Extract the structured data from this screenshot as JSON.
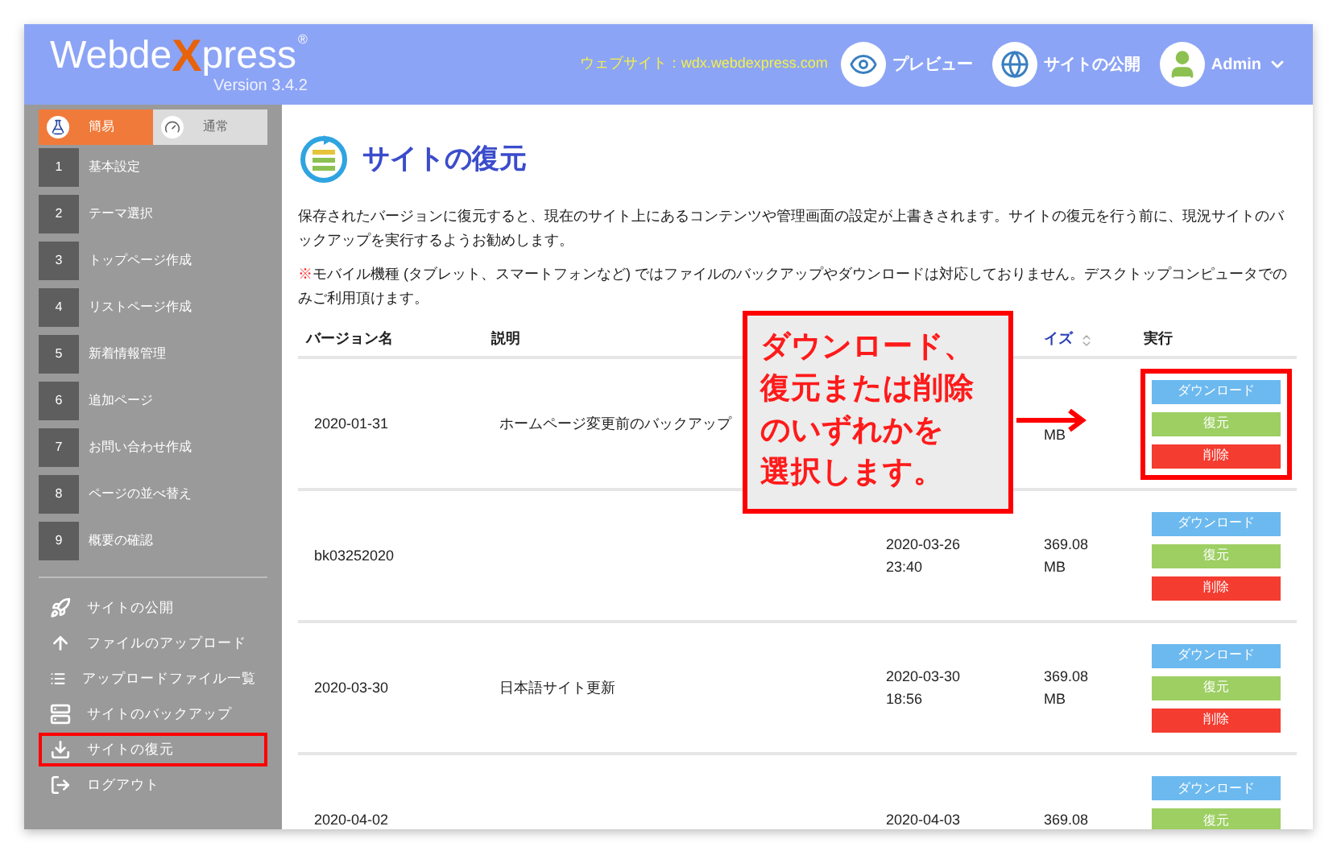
{
  "header": {
    "logo_parts": [
      "Webde",
      "X",
      "press"
    ],
    "registered": "®",
    "version": "Version 3.4.2",
    "website": "ウェブサイト：wdx.webdexpress.com",
    "nav": [
      {
        "kind": "preview",
        "label": "プレビュー"
      },
      {
        "kind": "publish",
        "label": "サイトの公開"
      }
    ],
    "user": {
      "name": "Admin"
    }
  },
  "sidebar": {
    "mode_tabs": [
      {
        "kind": "simple",
        "label": "簡易",
        "selected": true
      },
      {
        "kind": "normal",
        "label": "通常",
        "selected": false
      }
    ],
    "steps": [
      {
        "number": "1",
        "label": "基本設定"
      },
      {
        "number": "2",
        "label": "テーマ選択"
      },
      {
        "number": "3",
        "label": "トップページ作成"
      },
      {
        "number": "4",
        "label": "リストページ作成"
      },
      {
        "number": "5",
        "label": "新着情報管理"
      },
      {
        "number": "6",
        "label": "追加ページ"
      },
      {
        "number": "7",
        "label": "お問い合わせ作成"
      },
      {
        "number": "8",
        "label": "ページの並べ替え"
      },
      {
        "number": "9",
        "label": "概要の確認"
      }
    ],
    "menu": [
      {
        "kind": "publish",
        "label": "サイトの公開",
        "highlighted": false
      },
      {
        "kind": "upload",
        "label": "ファイルのアップロード",
        "highlighted": false
      },
      {
        "kind": "list",
        "label": "アップロードファイル一覧",
        "highlighted": false
      },
      {
        "kind": "backup",
        "label": "サイトのバックアップ",
        "highlighted": false
      },
      {
        "kind": "restore",
        "label": "サイトの復元",
        "highlighted": true
      },
      {
        "kind": "logout",
        "label": "ログアウト",
        "highlighted": false
      }
    ]
  },
  "main": {
    "title": "サイトの復元",
    "description": "保存されたバージョンに復元すると、現在のサイト上にあるコンテンツや管理画面の設定が上書きされます。サイトの復元を行う前に、現況サイトのバックアップを実行するようお勧めします。",
    "note": {
      "mark": "※",
      "text": "モバイル機種 (タブレット、スマートフォンなど) ではファイルのバックアップやダウンロードは対応しておりません。デスクトップコンピュータでのみご利用頂けます。"
    },
    "table": {
      "columns": [
        {
          "label": "バージョン名",
          "sortable": false
        },
        {
          "label": "説明",
          "sortable": false
        },
        {},
        {
          "label": "イズ",
          "sortable": true
        },
        {
          "label": "実行",
          "sortable": false
        }
      ],
      "rows": [
        {
          "version": "2020-01-31",
          "description": "ホームページ変更前のバックアップ",
          "size_unit": "MB",
          "highlighted": true,
          "actions": [
            {
              "kind": "download",
              "label": "ダウンロード"
            },
            {
              "kind": "restore",
              "label": "復元"
            },
            {
              "kind": "delete",
              "label": "削除"
            }
          ]
        },
        {
          "version": "bk03252020",
          "date": "2020-03-26",
          "time": "23:40",
          "size": "369.08",
          "size_unit": "MB",
          "highlighted": false,
          "actions": [
            {
              "kind": "download",
              "label": "ダウンロード"
            },
            {
              "kind": "restore",
              "label": "復元"
            },
            {
              "kind": "delete",
              "label": "削除"
            }
          ]
        },
        {
          "version": "2020-03-30",
          "description": "日本語サイト更新",
          "date": "2020-03-30",
          "time": "18:56",
          "size": "369.08",
          "size_unit": "MB",
          "highlighted": false,
          "actions": [
            {
              "kind": "download",
              "label": "ダウンロード"
            },
            {
              "kind": "restore",
              "label": "復元"
            },
            {
              "kind": "delete",
              "label": "削除"
            }
          ]
        },
        {
          "version": "2020-04-02",
          "date": "2020-04-03",
          "size": "369.08",
          "highlighted": false,
          "actions": [
            {
              "kind": "download",
              "label": "ダウンロード"
            },
            {
              "kind": "restore",
              "label": "復元"
            }
          ]
        }
      ]
    },
    "callout": {
      "lines": [
        "ダウンロード、",
        "復元または削除",
        "のいずれかを",
        "選択します。"
      ]
    }
  }
}
